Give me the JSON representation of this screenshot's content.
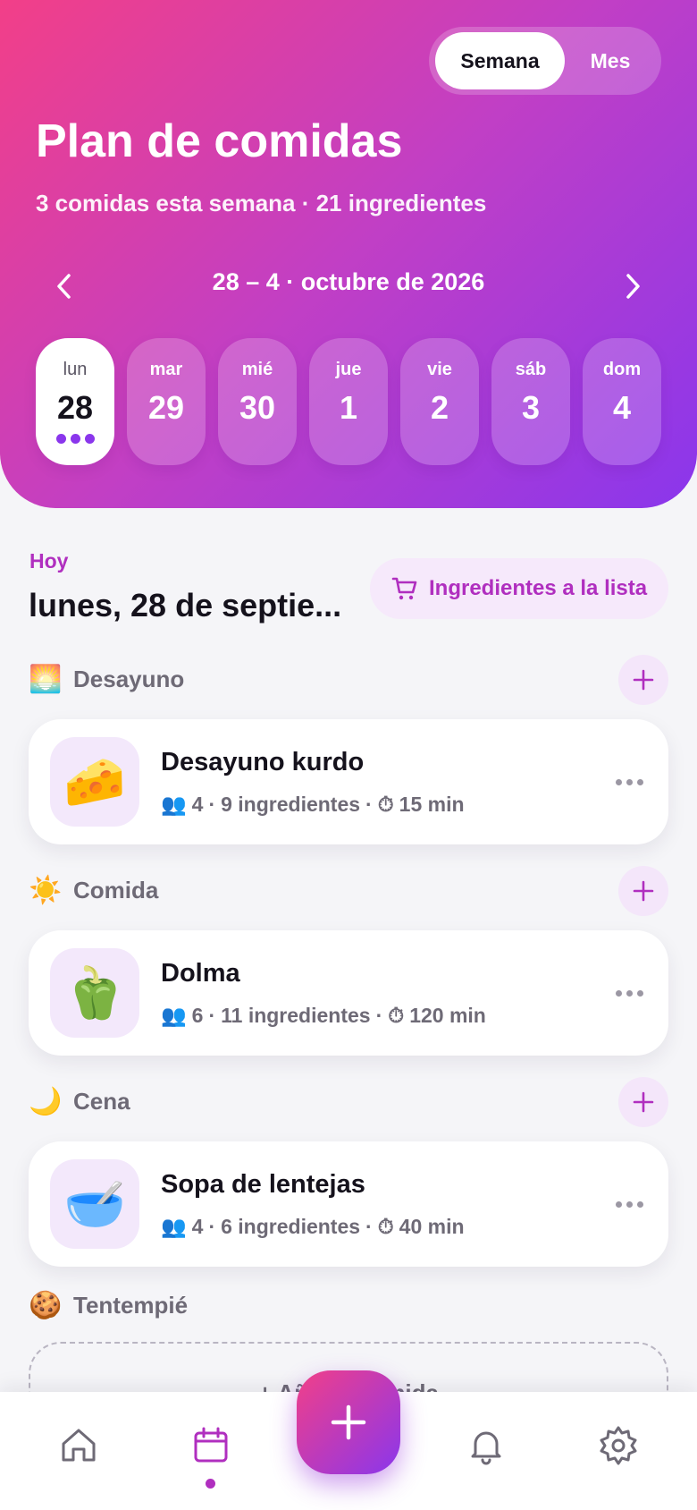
{
  "header": {
    "view_toggle": {
      "week_label": "Semana",
      "month_label": "Mes",
      "selected": "Semana"
    },
    "title": "Plan de comidas",
    "subtitle": "3 comidas esta semana · 21 ingredientes",
    "date_range": "28 – 4 · octubre de 2026",
    "days": [
      {
        "name": "lun",
        "num": "28",
        "active": true,
        "meal_dots": 3
      },
      {
        "name": "mar",
        "num": "29",
        "active": false
      },
      {
        "name": "mié",
        "num": "30",
        "active": false
      },
      {
        "name": "jue",
        "num": "1",
        "active": false
      },
      {
        "name": "vie",
        "num": "2",
        "active": false
      },
      {
        "name": "sáb",
        "num": "3",
        "active": false
      },
      {
        "name": "dom",
        "num": "4",
        "active": false
      }
    ]
  },
  "today": {
    "label": "Hoy",
    "date": "lunes, 28 de septie...",
    "shopping_button": "Ingredientes a la lista"
  },
  "meals": [
    {
      "section": "Desayuno",
      "section_emoji": "🌅",
      "title": "Desayuno kurdo",
      "emoji": "🧀",
      "people": "4",
      "ingredients": "9 ingredientes",
      "time": "15 min"
    },
    {
      "section": "Comida",
      "section_emoji": "☀️",
      "title": "Dolma",
      "emoji": "🫑",
      "people": "6",
      "ingredients": "11 ingredientes",
      "time": "120 min"
    },
    {
      "section": "Cena",
      "section_emoji": "🌙",
      "title": "Sopa de lentejas",
      "emoji": "🥣",
      "people": "4",
      "ingredients": "6 ingredientes",
      "time": "40 min"
    }
  ],
  "snack": {
    "section": "Tentempié",
    "section_emoji": "🍪",
    "add_label": "+ Añadir comida"
  },
  "meta_icons": {
    "people": "👥",
    "time": "⏱",
    "separator": "·"
  },
  "tabbar": {
    "items": [
      "home-icon",
      "calendar-icon",
      "add-icon",
      "bell-icon",
      "gear-icon"
    ],
    "active": "calendar-icon"
  },
  "colors": {
    "accent": "#b02fbf",
    "gradient_start": "#f23f88",
    "gradient_end": "#8a36ec"
  }
}
